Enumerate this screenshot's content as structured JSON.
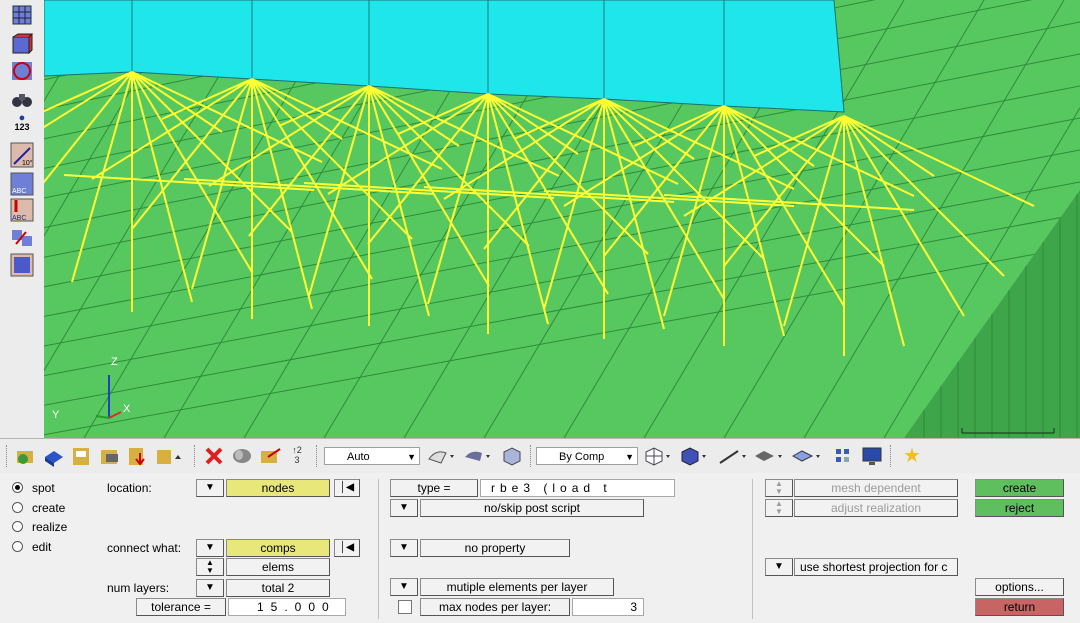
{
  "left_toolbar": {
    "icons": [
      "mesh-icon",
      "faces-icon",
      "sphere-icon",
      "binoculars-icon",
      "node-number-icon",
      "angle-icon",
      "label-abc-icon",
      "vertical-abc-icon",
      "transform-icon",
      "panel-icon"
    ],
    "number_badge": "123",
    "angle_label": "10°",
    "abc_label": "ABC"
  },
  "viewport": {
    "axis_z": "Z",
    "axis_y": "Y",
    "axis_x": "X",
    "colors": {
      "ground": "#57c85f",
      "solid": "#1ee6ea",
      "spider": "#ffff33",
      "mesh_line": "#2e8b3a"
    }
  },
  "main_toolbar": {
    "auto_label": "Auto",
    "bycomp_label": "By Comp"
  },
  "panel": {
    "radios": [
      {
        "label": "spot",
        "selected": true
      },
      {
        "label": "create",
        "selected": false
      },
      {
        "label": "realize",
        "selected": false
      },
      {
        "label": "edit",
        "selected": false
      }
    ],
    "location_label": "location:",
    "location_value": "nodes",
    "connect_label": "connect what:",
    "connect_value": "comps",
    "elems_label": "elems",
    "num_layers_label": "num layers:",
    "num_layers_value": "total 2",
    "tolerance_label": "tolerance =",
    "tolerance_value": "15.000",
    "type_label": "type =",
    "type_value": "rbe3 (load t",
    "post_script": "no/skip post script",
    "property": "no property",
    "multiple_elems": "mutiple elements per layer",
    "max_nodes_label": "max nodes per layer:",
    "max_nodes_value": "3",
    "mesh_dependent": "mesh dependent",
    "adjust_realization": "adjust realization",
    "projection": "use shortest projection for c",
    "create": "create",
    "reject": "reject",
    "options": "options...",
    "return": "return"
  }
}
